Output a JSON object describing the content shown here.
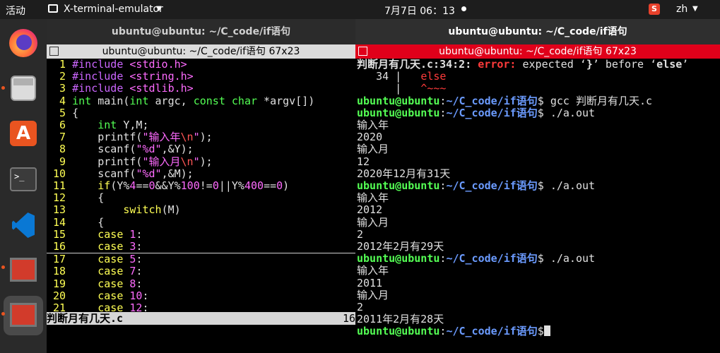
{
  "topbar": {
    "activities": "活动",
    "app_name": "X-terminal-emulator",
    "clock": "7月7日  06：13",
    "lang": "zh"
  },
  "left_window": {
    "window_title": "ubuntu@ubuntu: ~/C_code/if语句",
    "xterm_title": "ubuntu@ubuntu: ~/C_code/if语句 67x23",
    "code_lines": [
      {
        "n": "1",
        "parts": [
          [
            "pp",
            "#include "
          ],
          [
            "st",
            "<stdio.h>"
          ]
        ]
      },
      {
        "n": "2",
        "parts": [
          [
            "pp",
            "#include "
          ],
          [
            "st",
            "<string.h>"
          ]
        ]
      },
      {
        "n": "3",
        "parts": [
          [
            "pp",
            "#include "
          ],
          [
            "st",
            "<stdlib.h>"
          ]
        ]
      },
      {
        "n": "4",
        "parts": [
          [
            "ty",
            "int"
          ],
          [
            "wt",
            " main("
          ],
          [
            "ty",
            "int"
          ],
          [
            "wt",
            " argc, "
          ],
          [
            "ty",
            "const char"
          ],
          [
            "wt",
            " *argv[])"
          ]
        ]
      },
      {
        "n": "5",
        "parts": [
          [
            "wt",
            "{"
          ]
        ]
      },
      {
        "n": "6",
        "parts": [
          [
            "wt",
            "    "
          ],
          [
            "ty",
            "int"
          ],
          [
            "wt",
            " Y,M;"
          ]
        ]
      },
      {
        "n": "7",
        "parts": [
          [
            "wt",
            "    printf("
          ],
          [
            "st",
            "\"输入年"
          ],
          [
            "ct",
            "\\n"
          ],
          [
            "st",
            "\""
          ],
          [
            "wt",
            ");"
          ]
        ]
      },
      {
        "n": "8",
        "parts": [
          [
            "wt",
            "    scanf("
          ],
          [
            "st",
            "\"%d\""
          ],
          [
            "wt",
            ",&Y);"
          ]
        ]
      },
      {
        "n": "9",
        "parts": [
          [
            "wt",
            "    printf("
          ],
          [
            "st",
            "\"输入月"
          ],
          [
            "ct",
            "\\n"
          ],
          [
            "st",
            "\""
          ],
          [
            "wt",
            ");"
          ]
        ]
      },
      {
        "n": "10",
        "parts": [
          [
            "wt",
            "    scanf("
          ],
          [
            "st",
            "\"%d\""
          ],
          [
            "wt",
            ",&M);"
          ]
        ]
      },
      {
        "n": "11",
        "parts": [
          [
            "wt",
            "    "
          ],
          [
            "kw",
            "if"
          ],
          [
            "wt",
            "(Y%"
          ],
          [
            "nm",
            "4"
          ],
          [
            "wt",
            "=="
          ],
          [
            "nm",
            "0"
          ],
          [
            "wt",
            "&&Y%"
          ],
          [
            "nm",
            "100"
          ],
          [
            "wt",
            "!="
          ],
          [
            "nm",
            "0"
          ],
          [
            "wt",
            "||Y%"
          ],
          [
            "nm",
            "400"
          ],
          [
            "wt",
            "=="
          ],
          [
            "nm",
            "0"
          ],
          [
            "wt",
            ")"
          ]
        ]
      },
      {
        "n": "12",
        "parts": [
          [
            "wt",
            "    {"
          ]
        ]
      },
      {
        "n": "13",
        "parts": [
          [
            "wt",
            "        "
          ],
          [
            "kw",
            "switch"
          ],
          [
            "wt",
            "(M)"
          ]
        ]
      },
      {
        "n": "14",
        "parts": [
          [
            "wt",
            "    {"
          ]
        ]
      },
      {
        "n": "15",
        "parts": [
          [
            "wt",
            "    "
          ],
          [
            "kw",
            "case"
          ],
          [
            "wt",
            " "
          ],
          [
            "nm",
            "1"
          ],
          [
            "wt",
            ":"
          ]
        ]
      },
      {
        "n": "16",
        "parts": [
          [
            "wt",
            "    "
          ],
          [
            "kw",
            "case"
          ],
          [
            "wt",
            " "
          ],
          [
            "nm",
            "3"
          ],
          [
            "wt",
            ":"
          ]
        ]
      },
      {
        "n": "17",
        "parts": [
          [
            "wt",
            "    "
          ],
          [
            "kw",
            "case"
          ],
          [
            "wt",
            " "
          ],
          [
            "nm",
            "5"
          ],
          [
            "wt",
            ":"
          ]
        ]
      },
      {
        "n": "18",
        "parts": [
          [
            "wt",
            "    "
          ],
          [
            "kw",
            "case"
          ],
          [
            "wt",
            " "
          ],
          [
            "nm",
            "7"
          ],
          [
            "wt",
            ":"
          ]
        ]
      },
      {
        "n": "19",
        "parts": [
          [
            "wt",
            "    "
          ],
          [
            "kw",
            "case"
          ],
          [
            "wt",
            " "
          ],
          [
            "nm",
            "8"
          ],
          [
            "wt",
            ":"
          ]
        ]
      },
      {
        "n": "20",
        "parts": [
          [
            "wt",
            "    "
          ],
          [
            "kw",
            "case"
          ],
          [
            "wt",
            " "
          ],
          [
            "nm",
            "10"
          ],
          [
            "wt",
            ":"
          ]
        ]
      },
      {
        "n": "21",
        "parts": [
          [
            "wt",
            "    "
          ],
          [
            "kw",
            "case"
          ],
          [
            "wt",
            " "
          ],
          [
            "nm",
            "12"
          ],
          [
            "wt",
            ":"
          ]
        ]
      }
    ],
    "status_file": "判断月有几天.c",
    "status_pos": "16"
  },
  "right_window": {
    "window_title": "ubuntu@ubuntu: ~/C_code/if语句",
    "xterm_title": "ubuntu@ubuntu: ~/C_code/if语句 67x23",
    "lines": [
      [
        [
          "wt bold",
          "判断月有几天.c:34:2: "
        ],
        [
          "rd bold",
          "error: "
        ],
        [
          "wt",
          "expected ‘"
        ],
        [
          "wt bold",
          "}"
        ],
        [
          "wt",
          "’ before ‘"
        ],
        [
          "wt bold",
          "else"
        ],
        [
          "wt",
          "’"
        ]
      ],
      [
        [
          "wt",
          "   34 |   "
        ],
        [
          "rd",
          "else"
        ]
      ],
      [
        [
          "wt",
          "      |   "
        ],
        [
          "rd",
          "^~~~"
        ]
      ],
      [
        [
          "gr",
          "ubuntu@ubuntu"
        ],
        [
          "wt",
          ":"
        ],
        [
          "bl",
          "~/C_code/if语句"
        ],
        [
          "wt",
          "$ gcc 判断月有几天.c"
        ]
      ],
      [
        [
          "gr",
          "ubuntu@ubuntu"
        ],
        [
          "wt",
          ":"
        ],
        [
          "bl",
          "~/C_code/if语句"
        ],
        [
          "wt",
          "$ ./a.out"
        ]
      ],
      [
        [
          "wt",
          "输入年"
        ]
      ],
      [
        [
          "wt",
          "2020"
        ]
      ],
      [
        [
          "wt",
          "输入月"
        ]
      ],
      [
        [
          "wt",
          "12"
        ]
      ],
      [
        [
          "wt",
          "2020年12月有31天"
        ]
      ],
      [
        [
          "gr",
          "ubuntu@ubuntu"
        ],
        [
          "wt",
          ":"
        ],
        [
          "bl",
          "~/C_code/if语句"
        ],
        [
          "wt",
          "$ ./a.out"
        ]
      ],
      [
        [
          "wt",
          "输入年"
        ]
      ],
      [
        [
          "wt",
          "2012"
        ]
      ],
      [
        [
          "wt",
          "输入月"
        ]
      ],
      [
        [
          "wt",
          "2"
        ]
      ],
      [
        [
          "wt",
          "2012年2月有29天"
        ]
      ],
      [
        [
          "gr",
          "ubuntu@ubuntu"
        ],
        [
          "wt",
          ":"
        ],
        [
          "bl",
          "~/C_code/if语句"
        ],
        [
          "wt",
          "$ ./a.out"
        ]
      ],
      [
        [
          "wt",
          "输入年"
        ]
      ],
      [
        [
          "wt",
          "2011"
        ]
      ],
      [
        [
          "wt",
          "输入月"
        ]
      ],
      [
        [
          "wt",
          "2"
        ]
      ],
      [
        [
          "wt",
          "2011年2月有28天"
        ]
      ],
      [
        [
          "gr",
          "ubuntu@ubuntu"
        ],
        [
          "wt",
          ":"
        ],
        [
          "bl",
          "~/C_code/if语句"
        ],
        [
          "wt",
          "$"
        ]
      ]
    ]
  }
}
